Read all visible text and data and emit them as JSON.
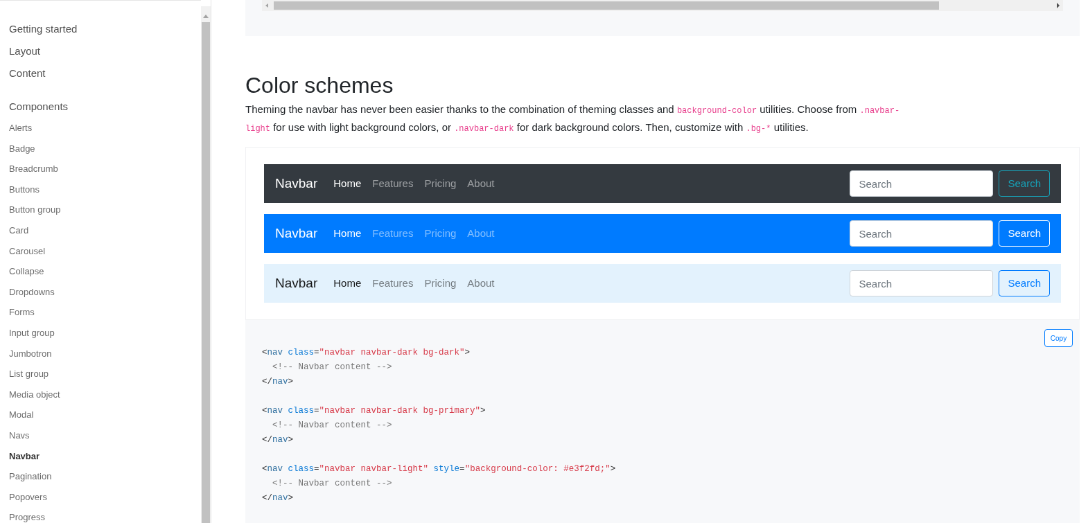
{
  "sidebar": {
    "sections": [
      {
        "label": "Getting started"
      },
      {
        "label": "Layout"
      },
      {
        "label": "Content"
      },
      {
        "label": "Components",
        "items": [
          {
            "label": "Alerts",
            "selected": false
          },
          {
            "label": "Badge",
            "selected": false
          },
          {
            "label": "Breadcrumb",
            "selected": false
          },
          {
            "label": "Buttons",
            "selected": false
          },
          {
            "label": "Button group",
            "selected": false
          },
          {
            "label": "Card",
            "selected": false
          },
          {
            "label": "Carousel",
            "selected": false
          },
          {
            "label": "Collapse",
            "selected": false
          },
          {
            "label": "Dropdowns",
            "selected": false
          },
          {
            "label": "Forms",
            "selected": false
          },
          {
            "label": "Input group",
            "selected": false
          },
          {
            "label": "Jumbotron",
            "selected": false
          },
          {
            "label": "List group",
            "selected": false
          },
          {
            "label": "Media object",
            "selected": false
          },
          {
            "label": "Modal",
            "selected": false
          },
          {
            "label": "Navs",
            "selected": false
          },
          {
            "label": "Navbar",
            "selected": true
          },
          {
            "label": "Pagination",
            "selected": false
          },
          {
            "label": "Popovers",
            "selected": false
          },
          {
            "label": "Progress",
            "selected": false
          }
        ]
      }
    ]
  },
  "section": {
    "title": "Color schemes",
    "paragraph": [
      {
        "kind": "text",
        "text": "Theming the navbar has never been easier thanks to the combination of theming classes and "
      },
      {
        "kind": "code",
        "text": "background-color"
      },
      {
        "kind": "text",
        "text": " utilities. Choose from "
      },
      {
        "kind": "code",
        "text": ".navbar-light"
      },
      {
        "kind": "text",
        "text": " for use with light background colors, or "
      },
      {
        "kind": "code",
        "text": ".navbar-dark"
      },
      {
        "kind": "text",
        "text": " for dark background colors. Then, customize with "
      },
      {
        "kind": "code",
        "text": ".bg-*"
      },
      {
        "kind": "text",
        "text": " utilities."
      }
    ]
  },
  "navbars": [
    {
      "kind": "dark",
      "brand": "Navbar",
      "links": [
        {
          "label": "Home",
          "selected": true
        },
        {
          "label": "Features",
          "selected": false
        },
        {
          "label": "Pricing",
          "selected": false
        },
        {
          "label": "About",
          "selected": false
        }
      ],
      "search_placeholder": "Search",
      "button": "Search"
    },
    {
      "kind": "primary",
      "brand": "Navbar",
      "links": [
        {
          "label": "Home",
          "selected": true
        },
        {
          "label": "Features",
          "selected": false
        },
        {
          "label": "Pricing",
          "selected": false
        },
        {
          "label": "About",
          "selected": false
        }
      ],
      "search_placeholder": "Search",
      "button": "Search"
    },
    {
      "kind": "light",
      "brand": "Navbar",
      "links": [
        {
          "label": "Home",
          "selected": true
        },
        {
          "label": "Features",
          "selected": false
        },
        {
          "label": "Pricing",
          "selected": false
        },
        {
          "label": "About",
          "selected": false
        }
      ],
      "search_placeholder": "Search",
      "button": "Search"
    }
  ],
  "code": {
    "copy_button": "Copy",
    "snippets": [
      {
        "lines": [
          [
            {
              "kind": "punct",
              "text": "<"
            },
            {
              "kind": "tag",
              "text": "nav"
            },
            {
              "kind": "attr",
              "text": " class"
            },
            {
              "kind": "punct",
              "text": "="
            },
            {
              "kind": "str",
              "text": "\"navbar navbar-dark bg-dark\""
            },
            {
              "kind": "punct",
              "text": ">"
            }
          ],
          [
            {
              "kind": "comment",
              "text": "  <!-- Navbar content -->"
            }
          ],
          [
            {
              "kind": "punct",
              "text": "</"
            },
            {
              "kind": "tag",
              "text": "nav"
            },
            {
              "kind": "punct",
              "text": ">"
            }
          ]
        ]
      },
      {
        "lines": [
          [
            {
              "kind": "punct",
              "text": "<"
            },
            {
              "kind": "tag",
              "text": "nav"
            },
            {
              "kind": "attr",
              "text": " class"
            },
            {
              "kind": "punct",
              "text": "="
            },
            {
              "kind": "str",
              "text": "\"navbar navbar-dark bg-primary\""
            },
            {
              "kind": "punct",
              "text": ">"
            }
          ],
          [
            {
              "kind": "comment",
              "text": "  <!-- Navbar content -->"
            }
          ],
          [
            {
              "kind": "punct",
              "text": "</"
            },
            {
              "kind": "tag",
              "text": "nav"
            },
            {
              "kind": "punct",
              "text": ">"
            }
          ]
        ]
      },
      {
        "lines": [
          [
            {
              "kind": "punct",
              "text": "<"
            },
            {
              "kind": "tag",
              "text": "nav"
            },
            {
              "kind": "attr",
              "text": " class"
            },
            {
              "kind": "punct",
              "text": "="
            },
            {
              "kind": "str",
              "text": "\"navbar navbar-light\""
            },
            {
              "kind": "attr",
              "text": " style"
            },
            {
              "kind": "punct",
              "text": "="
            },
            {
              "kind": "str",
              "text": "\"background-color: #e3f2fd;\""
            },
            {
              "kind": "punct",
              "text": ">"
            }
          ],
          [
            {
              "kind": "comment",
              "text": "  <!-- Navbar content -->"
            }
          ],
          [
            {
              "kind": "punct",
              "text": "</"
            },
            {
              "kind": "tag",
              "text": "nav"
            },
            {
              "kind": "punct",
              "text": ">"
            }
          ]
        ]
      }
    ]
  }
}
